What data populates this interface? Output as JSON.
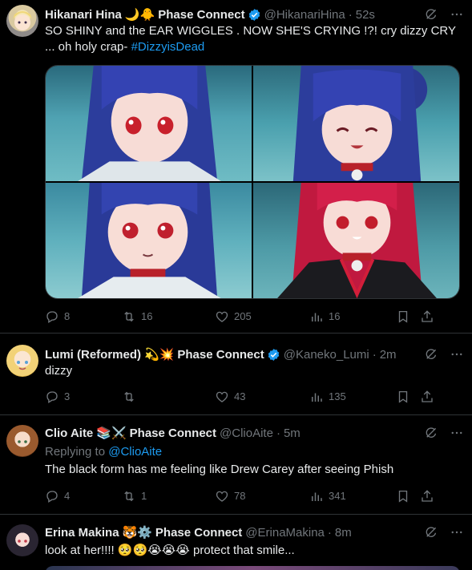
{
  "tweets": [
    {
      "name": "Hikanari Hina",
      "name_suffix": "Phase Connect",
      "handle": "@HikanariHina",
      "time": "52s",
      "text": "SO SHINY and the EAR WIGGLES . NOW SHE'S CRYING !?! cry dizzy CRY ... oh holy crap- ",
      "hashtag": "#DizzyisDead",
      "replies": "8",
      "retweets": "16",
      "likes": "205",
      "views": "16"
    },
    {
      "name": "Lumi (Reformed)",
      "name_suffix": "Phase Connect",
      "handle": "@Kaneko_Lumi",
      "time": "2m",
      "text": "dizzy",
      "replies": "3",
      "retweets": "",
      "likes": "43",
      "views": "135"
    },
    {
      "name": "Clio Aite",
      "name_suffix": "Phase Connect",
      "handle": "@ClioAite",
      "time": "5m",
      "replying_label": "Replying to ",
      "replying_handle": "@ClioAite",
      "text": "The black form has me feeling like Drew Carey after seeing Phish",
      "replies": "4",
      "retweets": "1",
      "likes": "78",
      "views": "341"
    },
    {
      "name": "Erina Makina",
      "name_suffix": "Phase Connect",
      "handle": "@ErinaMakina",
      "time": "8m",
      "text_a": "look at her!!!! ",
      "text_b": " protect that smile..."
    }
  ],
  "colors": {
    "accent": "#1d9bf0",
    "muted": "#71767b",
    "text": "#e7e9ea",
    "border": "#2f3336",
    "bg": "#000000"
  },
  "icons": [
    "reply-icon",
    "retweet-icon",
    "like-icon",
    "views-icon",
    "bookmark-icon",
    "share-icon",
    "grok-icon",
    "more-icon",
    "verified-icon"
  ]
}
